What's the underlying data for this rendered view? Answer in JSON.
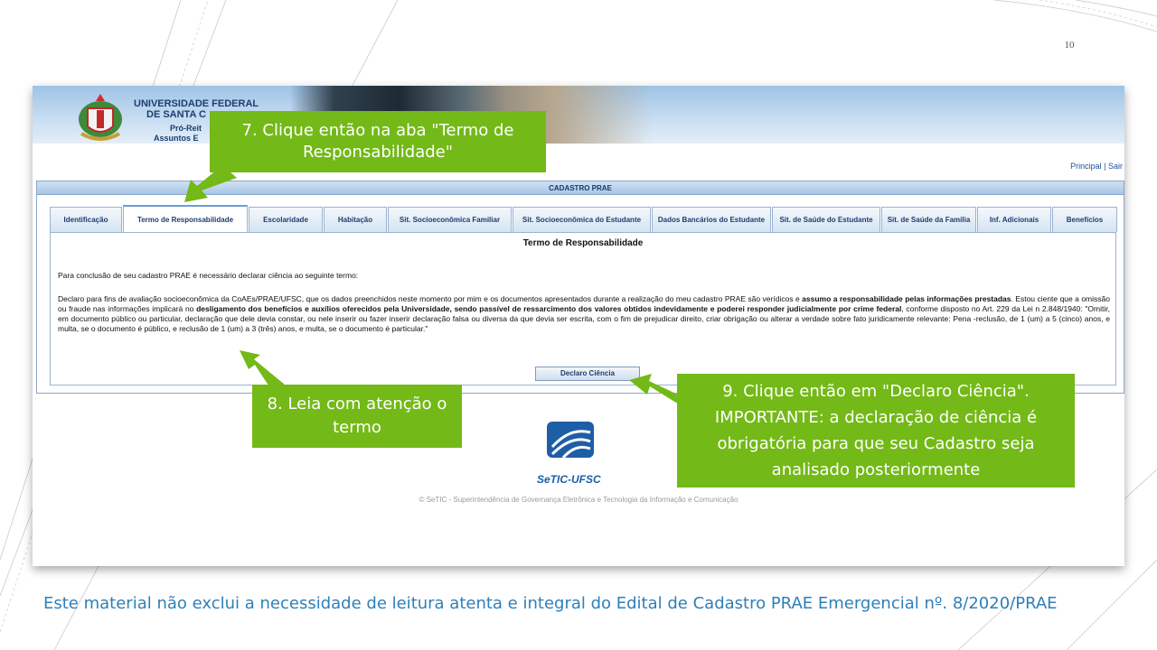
{
  "slide": {
    "page_number": "10",
    "footer_note": "Este material não exclui a necessidade de leitura atenta e integral do Edital de Cadastro PRAE Emergencial nº. 8/2020/PRAE"
  },
  "screenshot": {
    "header": {
      "university_line1": "UNIVERSIDADE FEDERAL",
      "university_line2": "DE SANTA C",
      "pro_reitoria_line1": "Pró-Reit",
      "pro_reitoria_line2": "Assuntos E"
    },
    "top_links": {
      "principal": "Principal",
      "separator": "|",
      "sair": "Sair"
    },
    "panel_title": "CADASTRO PRAE",
    "tabs": [
      {
        "label": "Identificação"
      },
      {
        "label": "Termo de Responsabilidade",
        "active": true
      },
      {
        "label": "Escolaridade"
      },
      {
        "label": "Habitação"
      },
      {
        "label": "Sit. Socioeconômica Familiar"
      },
      {
        "label": "Sit. Socioeconômica do Estudante"
      },
      {
        "label": "Dados Bancários do Estudante"
      },
      {
        "label": "Sit. de Saúde do Estudante"
      },
      {
        "label": "Sit. de Saúde da Família"
      },
      {
        "label": "Inf. Adicionais"
      },
      {
        "label": "Benefícios"
      }
    ],
    "content_title": "Termo de Responsabilidade",
    "intro": "Para conclusão de seu cadastro PRAE é necessário declarar ciência ao seguinte termo:",
    "declaration": {
      "p1": "Declaro para fins de avaliação socioeconômica da CoAEs/PRAE/UFSC, que os dados preenchidos neste momento por mim e os documentos apresentados durante a realização do meu cadastro PRAE são verídicos e ",
      "b1": "assumo a responsabilidade pelas informações prestadas",
      "p2": ". Estou ciente que a omissão ou fraude nas informações implicará no ",
      "b2": "desligamento dos benefícios e auxílios oferecidos pela Universidade, sendo passível de ressarcimento dos valores obtidos indevidamente e poderei responder judicialmente por crime federal",
      "p3": ", conforme disposto no Art. 229 da Lei n 2.848/1940: \"Omitir, em documento público ou particular, declaração que dele devia constar, ou nele inserir ou fazer inserir declaração falsa ou diversa da que devia ser escrita, com o fim de prejudicar direito, criar obrigação ou alterar a verdade sobre fato juridicamente relevante: Pena -reclusão, de 1 (um) a 5 (cinco) anos, e multa, se o documento é público, e reclusão de 1 (um) a 3 (três) anos, e multa, se o documento é particular.\""
    },
    "declaro_button": "Declaro Ciência",
    "setic_logo_text": "SeTIC-UFSC",
    "copyright": "© SeTIC - Superintendência de Governança Eletrônica e Tecnologia da Informação e Comunicação"
  },
  "callouts": {
    "step7": "7. Clique então na aba \"Termo de Responsabilidade\"",
    "step8": "8. Leia com atenção o termo",
    "step9": "9. Clique então em \"Declaro Ciência\". IMPORTANTE: a declaração de ciência é obrigatória para que seu Cadastro seja analisado posteriormente"
  },
  "colors": {
    "callout_green": "#73b917",
    "footer_blue": "#2e7fb8",
    "link_blue": "#1b4f9c"
  }
}
